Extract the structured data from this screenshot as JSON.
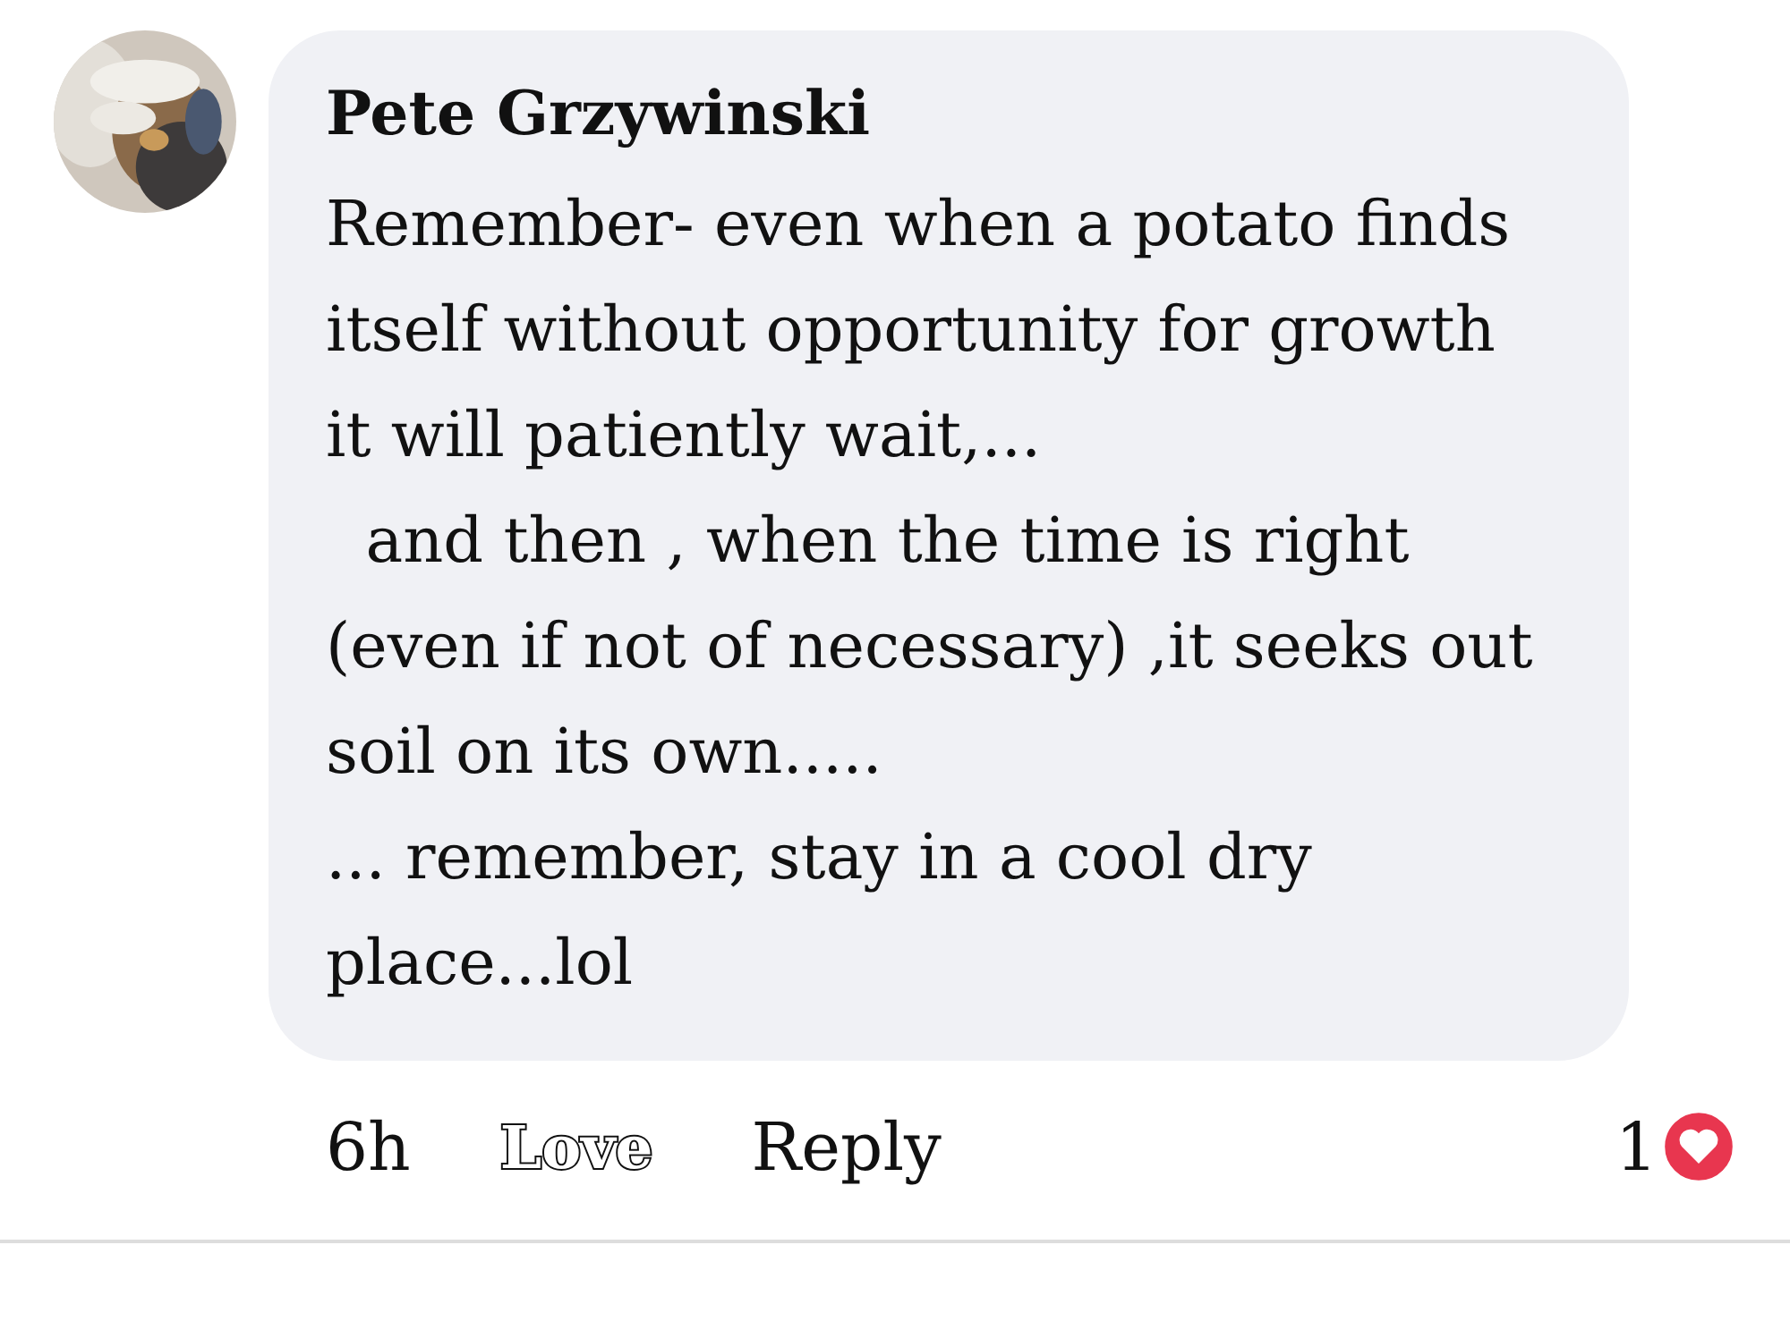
{
  "comment": {
    "author": "Pete Grzywinski",
    "text": "Remember- even when a potato finds itself without opportunity for growth\nit will patiently wait,...\n  and then , when the time is right (even if not of necessary) ,it seeks out soil on its own.....\n... remember, stay in a cool dry place...lol",
    "time": "6h",
    "actions": [
      {
        "label": "Love",
        "selected": true
      },
      {
        "label": "Reply",
        "selected": false
      }
    ],
    "reaction_count": "1"
  }
}
